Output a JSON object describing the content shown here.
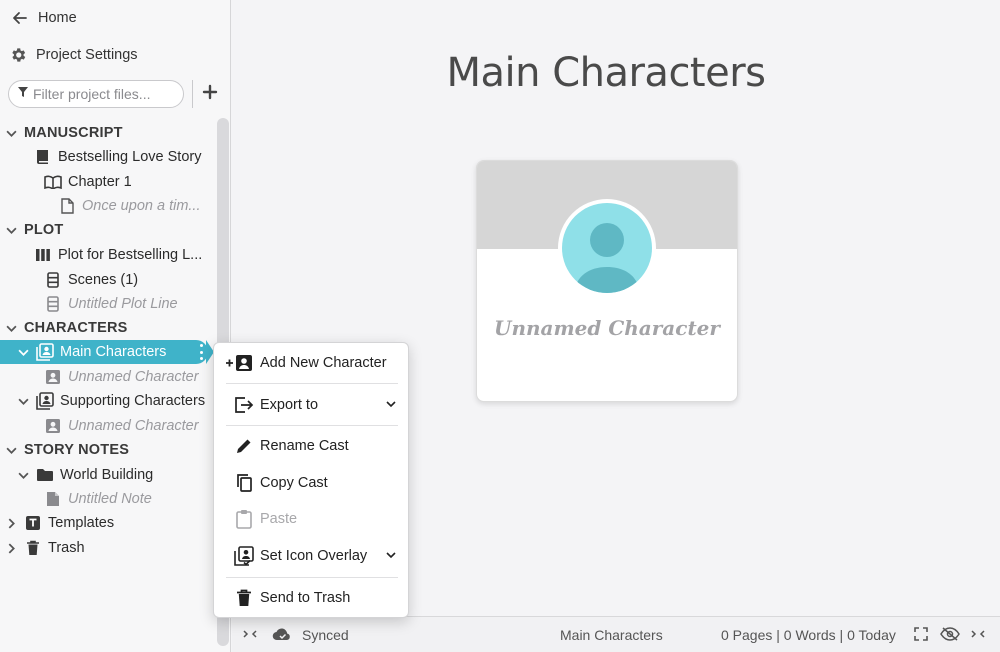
{
  "sidebar": {
    "home_label": "Home",
    "settings_label": "Project Settings",
    "filter_placeholder": "Filter project files...",
    "add_icon": "plus-icon",
    "tree": [
      {
        "label": "MANUSCRIPT",
        "kind": "section"
      },
      {
        "label": "Bestselling Love Story",
        "icon": "book-icon"
      },
      {
        "label": "Chapter 1",
        "icon": "open-book-icon"
      },
      {
        "label": "Once upon a tim...",
        "icon": "document-icon",
        "muted": true
      },
      {
        "label": "PLOT",
        "kind": "section"
      },
      {
        "label": "Plot for Bestselling L...",
        "icon": "columns-icon"
      },
      {
        "label": "Scenes  (1)",
        "icon": "stack-icon"
      },
      {
        "label": "Untitled Plot Line",
        "icon": "stack-icon",
        "muted": true
      },
      {
        "label": "CHARACTERS",
        "kind": "section"
      },
      {
        "label": "Main Characters",
        "icon": "cast-icon",
        "selected": true
      },
      {
        "label": "Unnamed Character",
        "icon": "person-card-icon",
        "muted": true
      },
      {
        "label": "Supporting Characters",
        "icon": "cast-icon"
      },
      {
        "label": "Unnamed Character",
        "icon": "person-card-icon",
        "muted": true
      },
      {
        "label": "STORY NOTES",
        "kind": "section"
      },
      {
        "label": "World Building",
        "icon": "folder-icon"
      },
      {
        "label": "Untitled Note",
        "icon": "note-icon",
        "muted": true
      },
      {
        "label": "Templates",
        "icon": "template-icon"
      },
      {
        "label": "Trash",
        "icon": "trash-icon"
      }
    ]
  },
  "main": {
    "title": "Main Characters",
    "card": {
      "name": "Unnamed Character"
    }
  },
  "context_menu": {
    "items": [
      {
        "label": "Add New Character",
        "icon": "add-person-icon"
      },
      {
        "label": "Export to",
        "icon": "export-icon",
        "submenu": true
      },
      {
        "label": "Rename Cast",
        "icon": "pencil-icon"
      },
      {
        "label": "Copy Cast",
        "icon": "copy-icon"
      },
      {
        "label": "Paste",
        "icon": "clipboard-icon",
        "disabled": true
      },
      {
        "label": "Set Icon Overlay",
        "icon": "icon-overlay-icon",
        "submenu": true
      },
      {
        "label": "Send to Trash",
        "icon": "trash-icon"
      }
    ]
  },
  "statusbar": {
    "sync_status": "Synced",
    "document_name": "Main Characters",
    "counts": "0 Pages | 0 Words | 0 Today"
  },
  "colors": {
    "accent": "#3fb3c9",
    "avatar": "#8fe0e8",
    "avatar_dark": "#5fb8c4"
  }
}
